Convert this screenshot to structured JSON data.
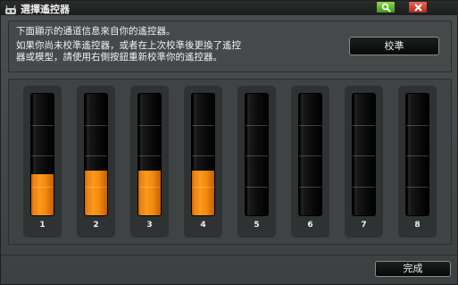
{
  "window": {
    "title": "選擇遙控器",
    "title_icon": "controller-icon",
    "help_icon": "magnifier-icon",
    "close_icon": "close-icon"
  },
  "info": {
    "line1": "下面顯示的通道信息來自你的遙控器。",
    "line2": "如果你尚未校準遙控器，或者在上次校準後更換了遙控",
    "line3": "器或模型，請使用右側按鈕重新校準你的遙控器。",
    "calibrate_label": "校準"
  },
  "channels": [
    {
      "label": "1",
      "level": 0.33
    },
    {
      "label": "2",
      "level": 0.36
    },
    {
      "label": "3",
      "level": 0.36
    },
    {
      "label": "4",
      "level": 0.36
    },
    {
      "label": "5",
      "level": 0
    },
    {
      "label": "6",
      "level": 0
    },
    {
      "label": "7",
      "level": 0
    },
    {
      "label": "8",
      "level": 0
    }
  ],
  "footer": {
    "done_label": "完成"
  },
  "colors": {
    "accent": "#f08a10",
    "help": "#5fb52a",
    "close": "#d04030"
  }
}
